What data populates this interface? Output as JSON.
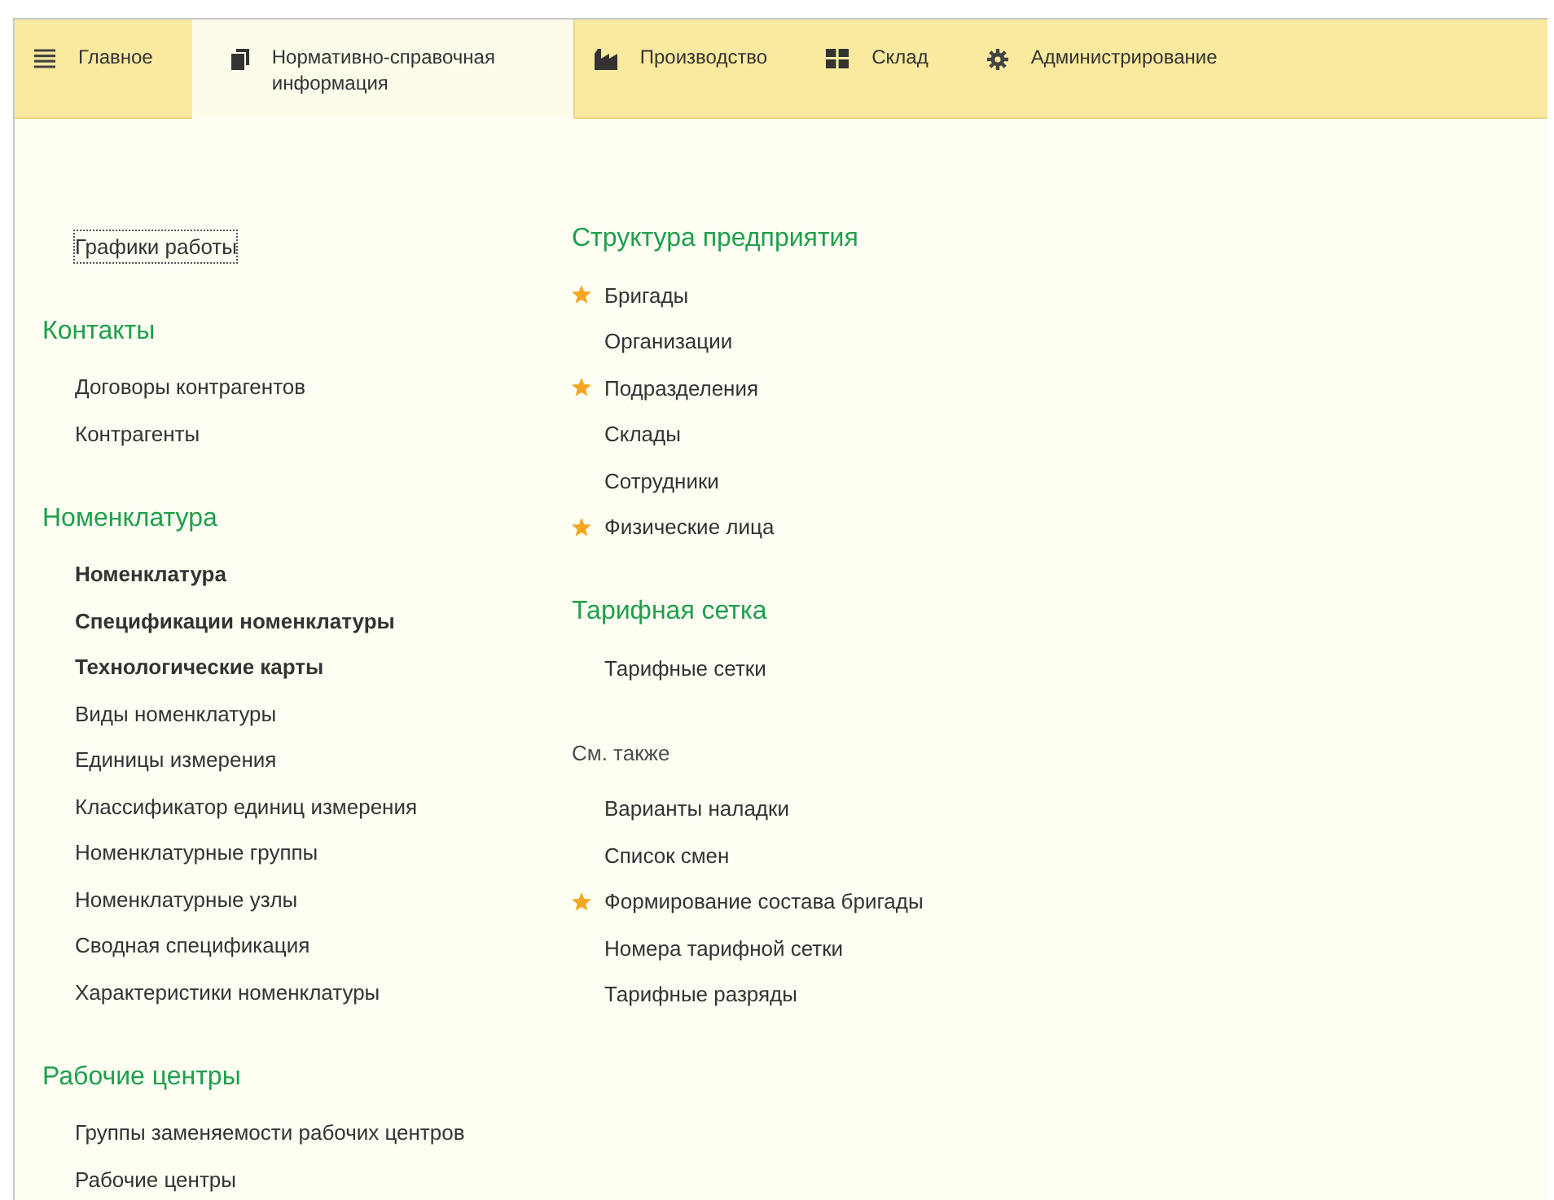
{
  "tabs": [
    {
      "label": "Главное",
      "selected": false
    },
    {
      "label": "Нормативно-справочная информация",
      "selected": true
    },
    {
      "label": "Производство",
      "selected": false
    },
    {
      "label": "Склад",
      "selected": false
    },
    {
      "label": "Администрирование",
      "selected": false
    }
  ],
  "columns": [
    [
      {
        "kind": "plain",
        "items": [
          {
            "label": "Графики работы",
            "bold": false,
            "starred": false,
            "focused": true
          }
        ]
      },
      {
        "kind": "section",
        "title": "Контакты",
        "items": [
          {
            "label": "Договоры контрагентов",
            "bold": false,
            "starred": false,
            "focused": false
          },
          {
            "label": "Контрагенты",
            "bold": false,
            "starred": false,
            "focused": false
          }
        ]
      },
      {
        "kind": "section",
        "title": "Номенклатура",
        "items": [
          {
            "label": "Номенклатура",
            "bold": true,
            "starred": false,
            "focused": false
          },
          {
            "label": "Спецификации номенклатуры",
            "bold": true,
            "starred": false,
            "focused": false
          },
          {
            "label": "Технологические карты",
            "bold": true,
            "starred": false,
            "focused": false
          },
          {
            "label": "Виды номенклатуры",
            "bold": false,
            "starred": false,
            "focused": false
          },
          {
            "label": "Единицы измерения",
            "bold": false,
            "starred": false,
            "focused": false
          },
          {
            "label": "Классификатор единиц измерения",
            "bold": false,
            "starred": false,
            "focused": false
          },
          {
            "label": "Номенклатурные группы",
            "bold": false,
            "starred": false,
            "focused": false
          },
          {
            "label": "Номенклатурные узлы",
            "bold": false,
            "starred": false,
            "focused": false
          },
          {
            "label": "Сводная спецификация",
            "bold": false,
            "starred": false,
            "focused": false
          },
          {
            "label": "Характеристики номенклатуры",
            "bold": false,
            "starred": false,
            "focused": false
          }
        ]
      },
      {
        "kind": "section",
        "title": "Рабочие центры",
        "items": [
          {
            "label": "Группы заменяемости рабочих центров",
            "bold": false,
            "starred": false,
            "focused": false
          },
          {
            "label": "Рабочие центры",
            "bold": false,
            "starred": false,
            "focused": false
          }
        ]
      }
    ],
    [
      {
        "kind": "section",
        "title": "Структура предприятия",
        "items": [
          {
            "label": "Бригады",
            "bold": false,
            "starred": true,
            "focused": false
          },
          {
            "label": "Организации",
            "bold": false,
            "starred": false,
            "focused": false
          },
          {
            "label": "Подразделения",
            "bold": false,
            "starred": true,
            "focused": false
          },
          {
            "label": "Склады",
            "bold": false,
            "starred": false,
            "focused": false
          },
          {
            "label": "Сотрудники",
            "bold": false,
            "starred": false,
            "focused": false
          },
          {
            "label": "Физические лица",
            "bold": false,
            "starred": true,
            "focused": false
          }
        ]
      },
      {
        "kind": "section",
        "title": "Тарифная сетка",
        "items": [
          {
            "label": "Тарифные сетки",
            "bold": false,
            "starred": false,
            "focused": false
          }
        ]
      },
      {
        "kind": "see_also",
        "title": "См. также",
        "items": [
          {
            "label": "Варианты наладки",
            "bold": false,
            "starred": false,
            "focused": false
          },
          {
            "label": "Список смен",
            "bold": false,
            "starred": false,
            "focused": false
          },
          {
            "label": "Формирование состава бригады",
            "bold": false,
            "starred": true,
            "focused": false
          },
          {
            "label": "Номера тарифной сетки",
            "bold": false,
            "starred": false,
            "focused": false
          },
          {
            "label": "Тарифные разряды",
            "bold": false,
            "starred": false,
            "focused": false
          }
        ]
      }
    ]
  ]
}
